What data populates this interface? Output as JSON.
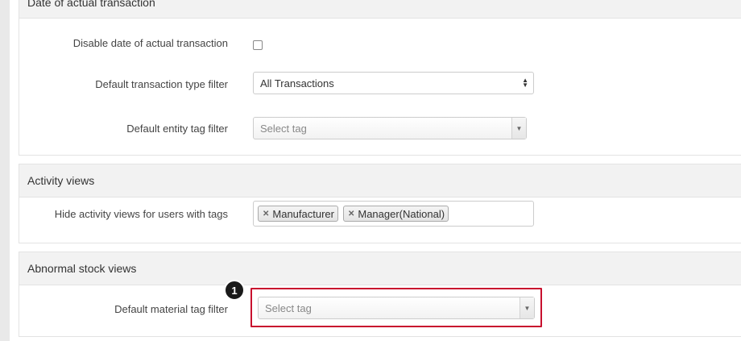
{
  "sections": {
    "date": {
      "title": "Date of actual transaction",
      "disable_label": "Disable date of actual transaction",
      "disable_checked": false,
      "type_filter_label": "Default transaction type filter",
      "type_filter_value": "All Transactions",
      "entity_tag_label": "Default entity tag filter",
      "entity_tag_placeholder": "Select tag"
    },
    "activity": {
      "title": "Activity views",
      "hide_label": "Hide activity views for users with tags",
      "tags": [
        "Manufacturer",
        "Manager(National)"
      ]
    },
    "abnormal": {
      "title": "Abnormal stock views",
      "material_tag_label": "Default material tag filter",
      "material_tag_placeholder": "Select tag"
    }
  },
  "annotation": {
    "step": "1",
    "color": "#c8102e"
  }
}
